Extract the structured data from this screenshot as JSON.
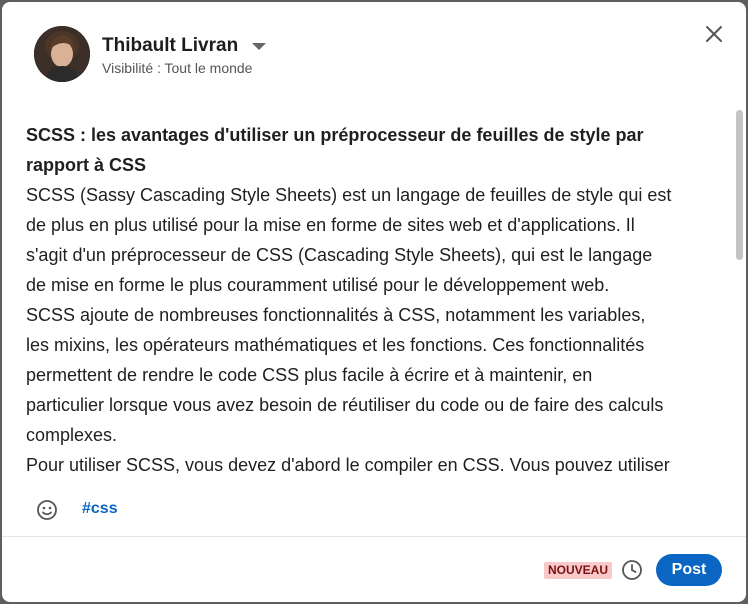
{
  "header": {
    "user_name": "Thibault Livran",
    "visibility": "Visibilité : Tout le monde",
    "close_icon": "close-icon",
    "caret_icon": "chevron-down-icon",
    "avatar": "avatar"
  },
  "post": {
    "title_line1": "SCSS : les avantages d'utiliser un préprocesseur de feuilles de style par",
    "title_line2": "rapport à CSS",
    "lines": [
      "SCSS (Sassy Cascading Style Sheets) est un langage de feuilles de style qui est",
      "de plus en plus utilisé pour la mise en forme de sites web et d'applications. Il",
      "s'agit d'un préprocesseur de CSS (Cascading Style Sheets), qui est le langage",
      "de mise en forme le plus couramment utilisé pour le développement web.",
      "SCSS ajoute de nombreuses fonctionnalités à CSS, notamment les variables,",
      "les mixins, les opérateurs mathématiques et les fonctions. Ces fonctionnalités",
      "permettent de rendre le code CSS plus facile à écrire et à maintenir, en",
      "particulier lorsque vous avez besoin de réutiliser du code ou de faire des calculs",
      "complexes.",
      "Pour utiliser SCSS, vous devez d'abord le compiler en CSS. Vous pouvez utiliser"
    ]
  },
  "toolbar": {
    "emoji_icon": "smiley-icon",
    "hashtag": "#css"
  },
  "footer": {
    "badge": "NOUVEAU",
    "clock_icon": "clock-icon",
    "post_label": "Post"
  },
  "colors": {
    "accent": "#0a66c2",
    "badge_bg": "#f9c8c8"
  }
}
